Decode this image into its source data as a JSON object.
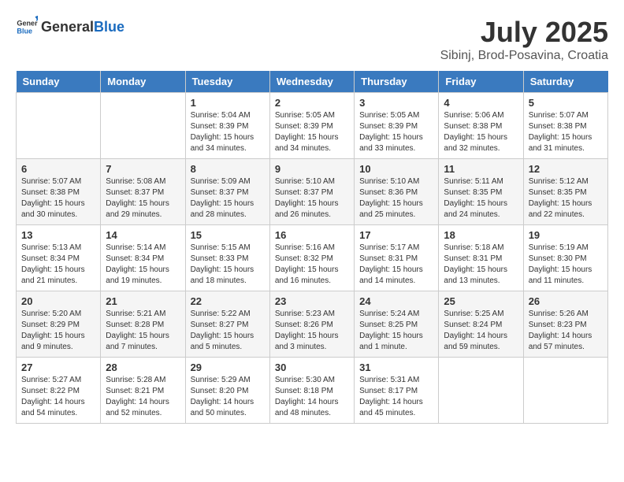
{
  "header": {
    "logo_general": "General",
    "logo_blue": "Blue",
    "month": "July 2025",
    "location": "Sibinj, Brod-Posavina, Croatia"
  },
  "columns": [
    "Sunday",
    "Monday",
    "Tuesday",
    "Wednesday",
    "Thursday",
    "Friday",
    "Saturday"
  ],
  "weeks": [
    [
      {
        "day": "",
        "info": ""
      },
      {
        "day": "",
        "info": ""
      },
      {
        "day": "1",
        "info": "Sunrise: 5:04 AM\nSunset: 8:39 PM\nDaylight: 15 hours and 34 minutes."
      },
      {
        "day": "2",
        "info": "Sunrise: 5:05 AM\nSunset: 8:39 PM\nDaylight: 15 hours and 34 minutes."
      },
      {
        "day": "3",
        "info": "Sunrise: 5:05 AM\nSunset: 8:39 PM\nDaylight: 15 hours and 33 minutes."
      },
      {
        "day": "4",
        "info": "Sunrise: 5:06 AM\nSunset: 8:38 PM\nDaylight: 15 hours and 32 minutes."
      },
      {
        "day": "5",
        "info": "Sunrise: 5:07 AM\nSunset: 8:38 PM\nDaylight: 15 hours and 31 minutes."
      }
    ],
    [
      {
        "day": "6",
        "info": "Sunrise: 5:07 AM\nSunset: 8:38 PM\nDaylight: 15 hours and 30 minutes."
      },
      {
        "day": "7",
        "info": "Sunrise: 5:08 AM\nSunset: 8:37 PM\nDaylight: 15 hours and 29 minutes."
      },
      {
        "day": "8",
        "info": "Sunrise: 5:09 AM\nSunset: 8:37 PM\nDaylight: 15 hours and 28 minutes."
      },
      {
        "day": "9",
        "info": "Sunrise: 5:10 AM\nSunset: 8:37 PM\nDaylight: 15 hours and 26 minutes."
      },
      {
        "day": "10",
        "info": "Sunrise: 5:10 AM\nSunset: 8:36 PM\nDaylight: 15 hours and 25 minutes."
      },
      {
        "day": "11",
        "info": "Sunrise: 5:11 AM\nSunset: 8:35 PM\nDaylight: 15 hours and 24 minutes."
      },
      {
        "day": "12",
        "info": "Sunrise: 5:12 AM\nSunset: 8:35 PM\nDaylight: 15 hours and 22 minutes."
      }
    ],
    [
      {
        "day": "13",
        "info": "Sunrise: 5:13 AM\nSunset: 8:34 PM\nDaylight: 15 hours and 21 minutes."
      },
      {
        "day": "14",
        "info": "Sunrise: 5:14 AM\nSunset: 8:34 PM\nDaylight: 15 hours and 19 minutes."
      },
      {
        "day": "15",
        "info": "Sunrise: 5:15 AM\nSunset: 8:33 PM\nDaylight: 15 hours and 18 minutes."
      },
      {
        "day": "16",
        "info": "Sunrise: 5:16 AM\nSunset: 8:32 PM\nDaylight: 15 hours and 16 minutes."
      },
      {
        "day": "17",
        "info": "Sunrise: 5:17 AM\nSunset: 8:31 PM\nDaylight: 15 hours and 14 minutes."
      },
      {
        "day": "18",
        "info": "Sunrise: 5:18 AM\nSunset: 8:31 PM\nDaylight: 15 hours and 13 minutes."
      },
      {
        "day": "19",
        "info": "Sunrise: 5:19 AM\nSunset: 8:30 PM\nDaylight: 15 hours and 11 minutes."
      }
    ],
    [
      {
        "day": "20",
        "info": "Sunrise: 5:20 AM\nSunset: 8:29 PM\nDaylight: 15 hours and 9 minutes."
      },
      {
        "day": "21",
        "info": "Sunrise: 5:21 AM\nSunset: 8:28 PM\nDaylight: 15 hours and 7 minutes."
      },
      {
        "day": "22",
        "info": "Sunrise: 5:22 AM\nSunset: 8:27 PM\nDaylight: 15 hours and 5 minutes."
      },
      {
        "day": "23",
        "info": "Sunrise: 5:23 AM\nSunset: 8:26 PM\nDaylight: 15 hours and 3 minutes."
      },
      {
        "day": "24",
        "info": "Sunrise: 5:24 AM\nSunset: 8:25 PM\nDaylight: 15 hours and 1 minute."
      },
      {
        "day": "25",
        "info": "Sunrise: 5:25 AM\nSunset: 8:24 PM\nDaylight: 14 hours and 59 minutes."
      },
      {
        "day": "26",
        "info": "Sunrise: 5:26 AM\nSunset: 8:23 PM\nDaylight: 14 hours and 57 minutes."
      }
    ],
    [
      {
        "day": "27",
        "info": "Sunrise: 5:27 AM\nSunset: 8:22 PM\nDaylight: 14 hours and 54 minutes."
      },
      {
        "day": "28",
        "info": "Sunrise: 5:28 AM\nSunset: 8:21 PM\nDaylight: 14 hours and 52 minutes."
      },
      {
        "day": "29",
        "info": "Sunrise: 5:29 AM\nSunset: 8:20 PM\nDaylight: 14 hours and 50 minutes."
      },
      {
        "day": "30",
        "info": "Sunrise: 5:30 AM\nSunset: 8:18 PM\nDaylight: 14 hours and 48 minutes."
      },
      {
        "day": "31",
        "info": "Sunrise: 5:31 AM\nSunset: 8:17 PM\nDaylight: 14 hours and 45 minutes."
      },
      {
        "day": "",
        "info": ""
      },
      {
        "day": "",
        "info": ""
      }
    ]
  ]
}
